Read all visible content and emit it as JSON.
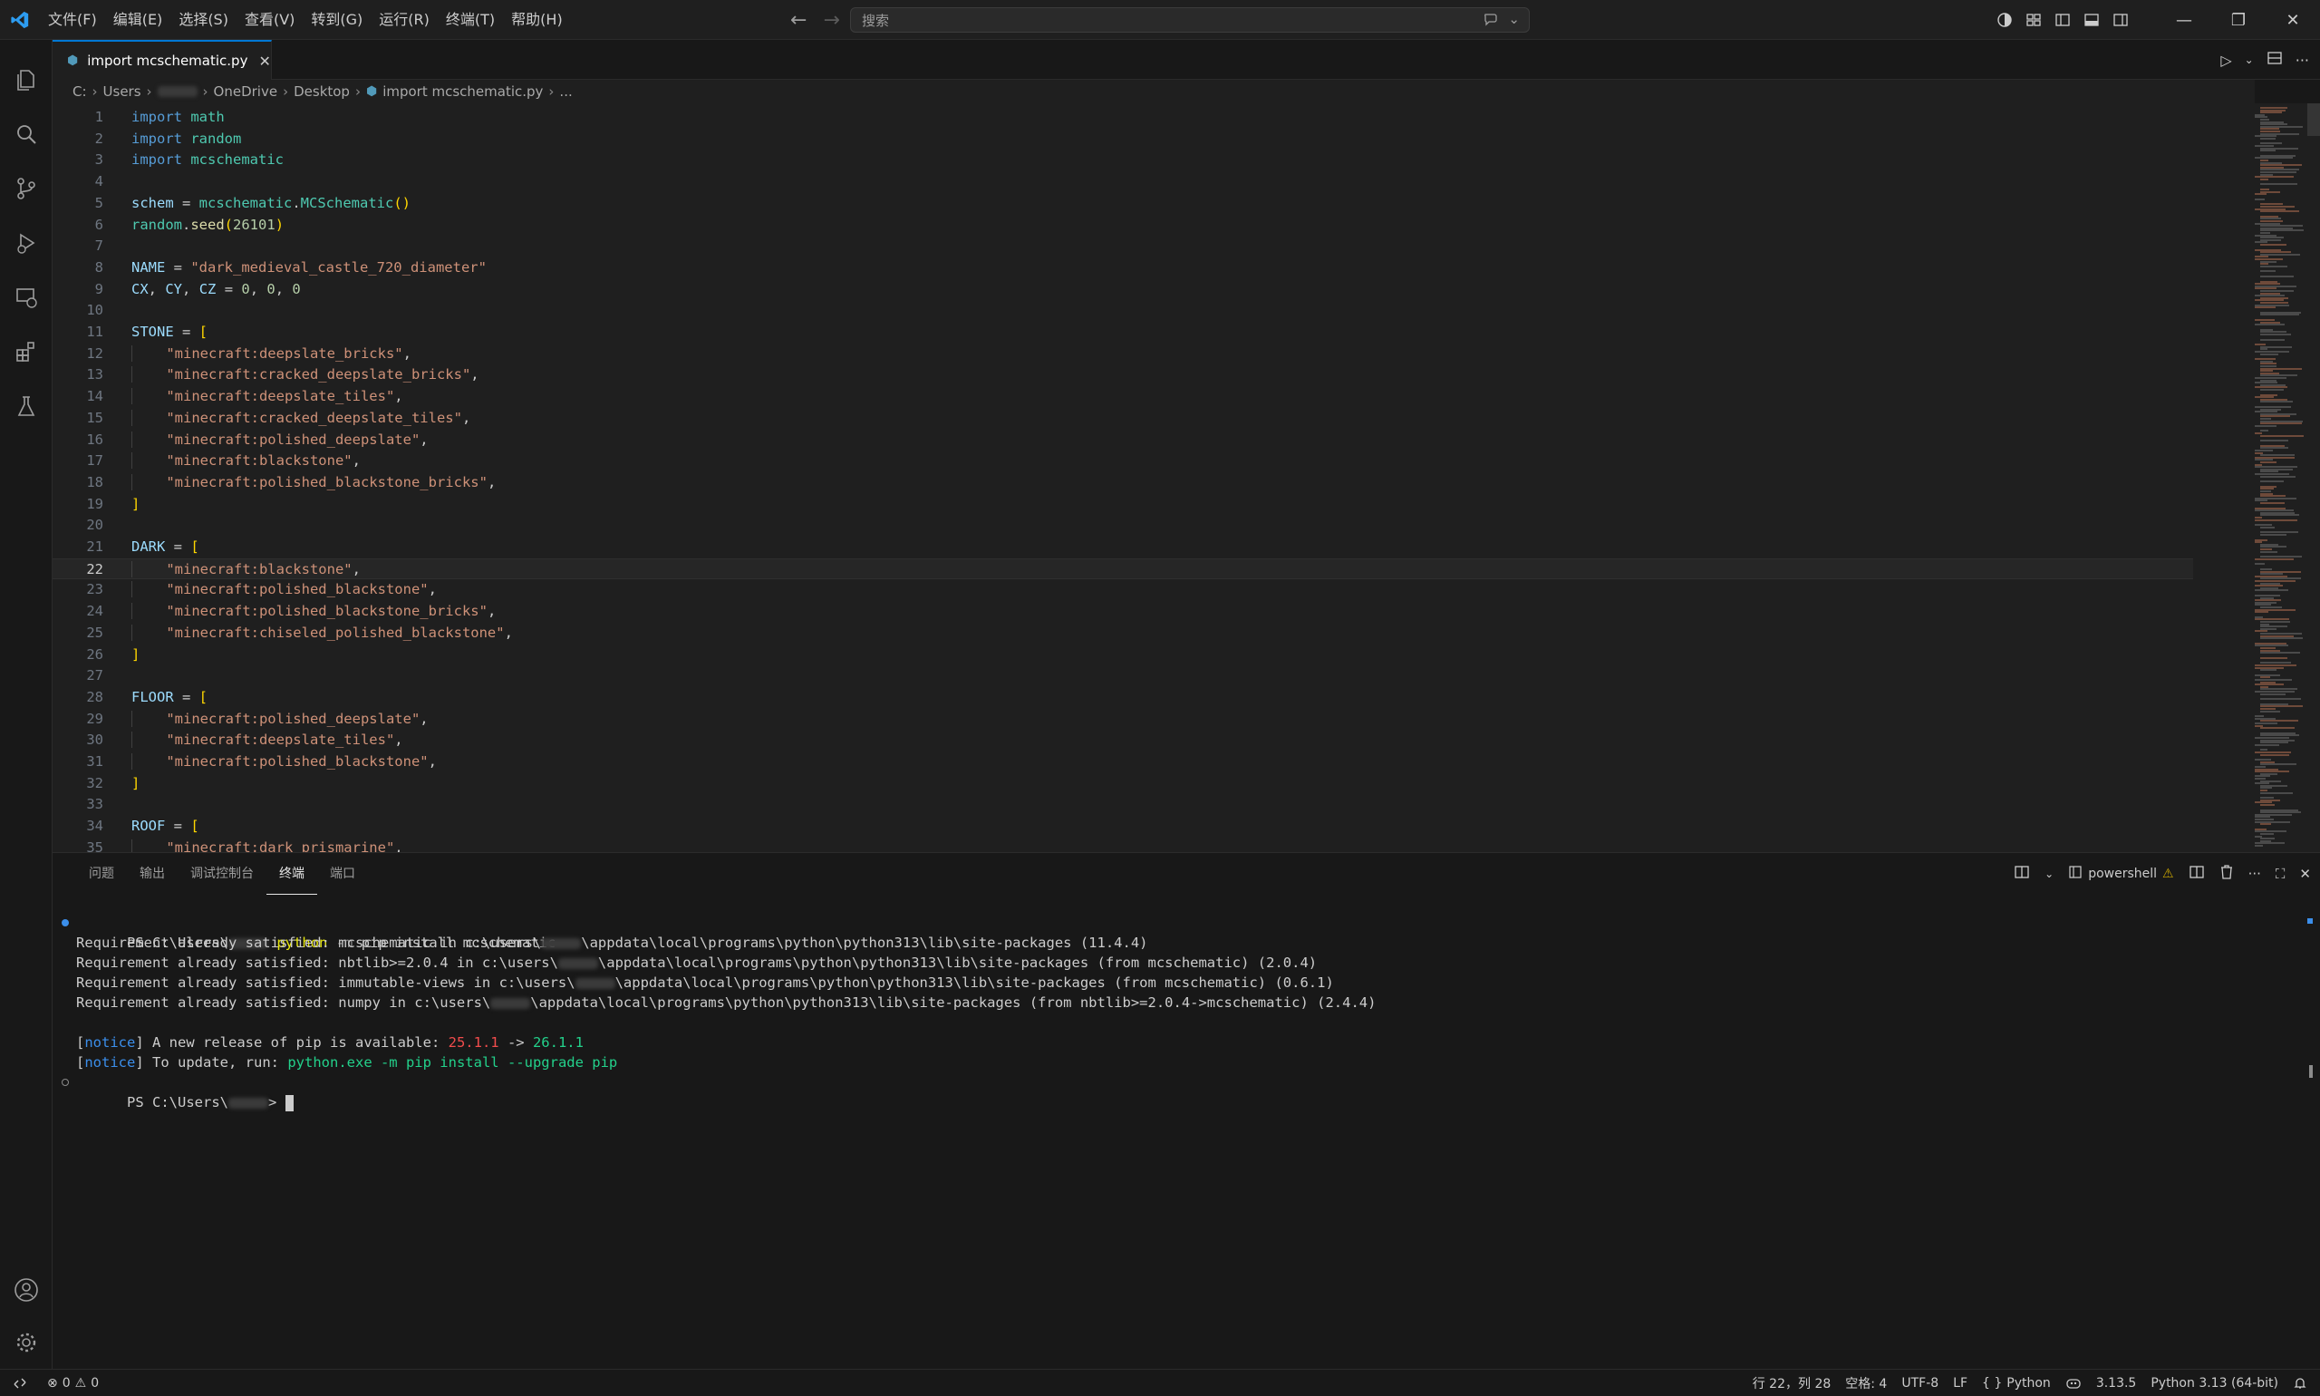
{
  "window": {
    "menu": [
      "文件(F)",
      "编辑(E)",
      "选择(S)",
      "查看(V)",
      "转到(G)",
      "运行(R)",
      "终端(T)",
      "帮助(H)"
    ],
    "search_placeholder": "搜索"
  },
  "tab": {
    "filename": "import mcschematic.py"
  },
  "breadcrumb": {
    "drive": "C:",
    "users": "Users",
    "onedrive": "OneDrive",
    "desktop": "Desktop",
    "file": "import mcschematic.py",
    "more": "..."
  },
  "editor": {
    "current_line": 22,
    "lines": [
      {
        "n": "1"
      },
      {
        "n": "2"
      },
      {
        "n": "3"
      },
      {
        "n": "4"
      },
      {
        "n": "5"
      },
      {
        "n": "6"
      },
      {
        "n": "7"
      },
      {
        "n": "8"
      },
      {
        "n": "9"
      },
      {
        "n": "10"
      },
      {
        "n": "11"
      },
      {
        "n": "12"
      },
      {
        "n": "13"
      },
      {
        "n": "14"
      },
      {
        "n": "15"
      },
      {
        "n": "16"
      },
      {
        "n": "17"
      },
      {
        "n": "18"
      },
      {
        "n": "19"
      },
      {
        "n": "20"
      },
      {
        "n": "21"
      },
      {
        "n": "22"
      },
      {
        "n": "23"
      },
      {
        "n": "24"
      },
      {
        "n": "25"
      },
      {
        "n": "26"
      },
      {
        "n": "27"
      },
      {
        "n": "28"
      },
      {
        "n": "29"
      },
      {
        "n": "30"
      },
      {
        "n": "31"
      },
      {
        "n": "32"
      },
      {
        "n": "33"
      },
      {
        "n": "34"
      },
      {
        "n": "35"
      }
    ],
    "code": {
      "l1": [
        "import",
        "math"
      ],
      "l2": [
        "import",
        "random"
      ],
      "l3": [
        "import",
        "mcschematic"
      ],
      "l5": [
        "schem",
        "mcschematic",
        "MCSchematic"
      ],
      "l6": [
        "random",
        "seed",
        "26101"
      ],
      "l8": [
        "NAME",
        "\"dark_medieval_castle_720_diameter\""
      ],
      "l9": [
        "CX",
        "CY",
        "CZ",
        "0",
        "0",
        "0"
      ],
      "l11": "STONE",
      "l12": "\"minecraft:deepslate_bricks\"",
      "l13": "\"minecraft:cracked_deepslate_bricks\"",
      "l14": "\"minecraft:deepslate_tiles\"",
      "l15": "\"minecraft:cracked_deepslate_tiles\"",
      "l16": "\"minecraft:polished_deepslate\"",
      "l17": "\"minecraft:blackstone\"",
      "l18": "\"minecraft:polished_blackstone_bricks\"",
      "l21": "DARK",
      "l22": "\"minecraft:blackstone\"",
      "l23": "\"minecraft:polished_blackstone\"",
      "l24": "\"minecraft:polished_blackstone_bricks\"",
      "l25": "\"minecraft:chiseled_polished_blackstone\"",
      "l28": "FLOOR",
      "l29": "\"minecraft:polished_deepslate\"",
      "l30": "\"minecraft:deepslate_tiles\"",
      "l31": "\"minecraft:polished_blackstone\"",
      "l34": "ROOF",
      "l35": "\"minecraft:dark_prismarine\""
    }
  },
  "panel": {
    "tabs": [
      "问题",
      "输出",
      "调试控制台",
      "终端",
      "端口"
    ],
    "active_tab": "终端",
    "shell": "powershell",
    "terminal": {
      "ps_prefix": "PS C:\\Users\\",
      "cmd_python": "python",
      "cmd_flag": "-m",
      "cmd_rest": "pip install mcschematic",
      "req1a": "Requirement already satisfied: mcschematic in c:\\users\\",
      "req1b": "\\appdata\\local\\programs\\python\\python313\\lib\\site-packages (11.4.4)",
      "req2a": "Requirement already satisfied: nbtlib>=2.0.4 in c:\\users\\",
      "req2b": "\\appdata\\local\\programs\\python\\python313\\lib\\site-packages (from mcschematic) (2.0.4)",
      "req3a": "Requirement already satisfied: immutable-views in c:\\users\\",
      "req3b": "\\appdata\\local\\programs\\python\\python313\\lib\\site-packages (from mcschematic) (0.6.1)",
      "req4a": "Requirement already satisfied: numpy in c:\\users\\",
      "req4b": "\\appdata\\local\\programs\\python\\python313\\lib\\site-packages (from nbtlib>=2.0.4->mcschematic) (2.4.4)",
      "notice": "notice",
      "notice1": " A new release of pip is available: ",
      "ver_old": "25.1.1",
      "arrow": " -> ",
      "ver_new": "26.1.1",
      "notice2": " To update, run: ",
      "update_cmd": "python.exe -m pip install --upgrade pip",
      "prompt_end": ">"
    }
  },
  "statusbar": {
    "errors": "0",
    "warnings": "0",
    "position": "行 22，列 28",
    "spaces": "空格: 4",
    "encoding": "UTF-8",
    "eol": "LF",
    "language": "Python",
    "version_short": "3.13.5",
    "interpreter": "Python 3.13 (64-bit)"
  },
  "colors": {
    "accent": "#0078d4",
    "editor_bg": "#1f1f1f",
    "string": "#ce9178",
    "keyword": "#569cd6",
    "module": "#4ec9b0"
  }
}
